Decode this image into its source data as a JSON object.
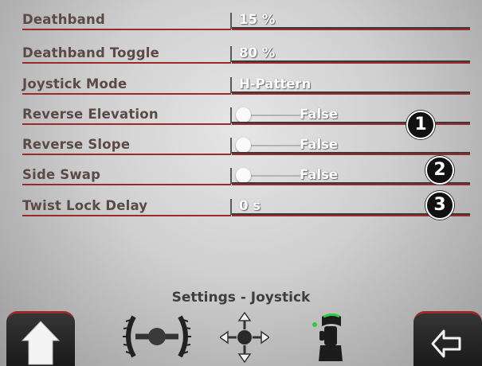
{
  "settings": [
    {
      "label": "Deathband",
      "value": "15 %",
      "type": "text"
    },
    {
      "label": "Deathband Toggle",
      "value": "80 %",
      "type": "text"
    },
    {
      "label": "Joystick Mode",
      "value": "H-Pattern",
      "type": "text"
    },
    {
      "label": "Reverse Elevation",
      "value": "False",
      "type": "toggle"
    },
    {
      "label": "Reverse Slope",
      "value": "False",
      "type": "toggle"
    },
    {
      "label": "Side Swap",
      "value": "False",
      "type": "toggle"
    },
    {
      "label": "Twist Lock Delay",
      "value": "0 s",
      "type": "text"
    }
  ],
  "badges": [
    "1",
    "2",
    "3"
  ],
  "footer": {
    "title": "Settings - Joystick"
  },
  "icons": {
    "home": "home-icon",
    "steering": "steering-wheel-icon",
    "move": "move-arrows-icon",
    "joystick": "joystick-icon",
    "back": "back-arrow-icon"
  },
  "colors": {
    "accent_line": "#9c2a2a",
    "value_text": "#ffffff",
    "label_text": "#5a4a48"
  }
}
